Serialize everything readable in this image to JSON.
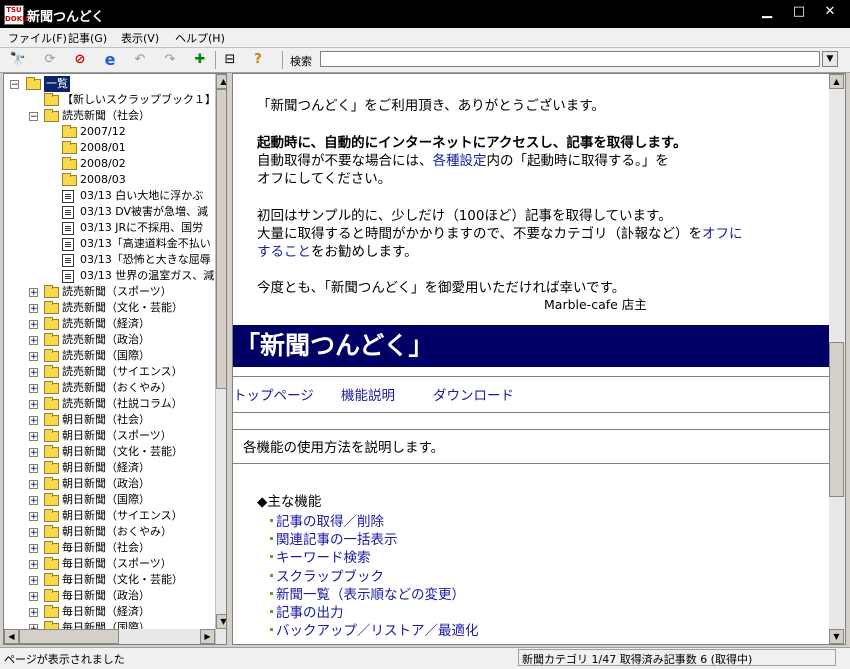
{
  "window": {
    "title": "新聞つんどく",
    "icon_text": "TSU DOKU"
  },
  "menu": [
    "ファイル(F)",
    "記事(G)",
    "表示(V)",
    "ヘルプ(H)"
  ],
  "toolbar": {
    "search_label": "検索",
    "search_value": "",
    "icons": [
      "binoculars-icon",
      "refresh-icon",
      "stop-icon",
      "ie-icon",
      "undo-icon",
      "redo-icon",
      "add-icon",
      "layout-icon",
      "help-icon"
    ]
  },
  "tree": {
    "root": "一覧",
    "items": [
      {
        "label": "【新しいスクラップブック１】",
        "type": "folder",
        "level": 1,
        "toggle": ""
      },
      {
        "label": "読売新聞（社会）",
        "type": "folder",
        "level": 1,
        "toggle": "-"
      },
      {
        "label": "2007/12",
        "type": "folder",
        "level": 2,
        "toggle": ""
      },
      {
        "label": "2008/01",
        "type": "folder",
        "level": 2,
        "toggle": ""
      },
      {
        "label": "2008/02",
        "type": "folder",
        "level": 2,
        "toggle": ""
      },
      {
        "label": "2008/03",
        "type": "folder",
        "level": 2,
        "toggle": ""
      },
      {
        "label": "03/13 白い大地に浮かぶ",
        "type": "doc",
        "level": 2,
        "toggle": ""
      },
      {
        "label": "03/13 DV被害が急増、減",
        "type": "doc",
        "level": 2,
        "toggle": ""
      },
      {
        "label": "03/13 JRに不採用、国労",
        "type": "doc",
        "level": 2,
        "toggle": ""
      },
      {
        "label": "03/13「高速道料金不払い",
        "type": "doc",
        "level": 2,
        "toggle": ""
      },
      {
        "label": "03/13「恐怖と大きな屈辱",
        "type": "doc",
        "level": 2,
        "toggle": ""
      },
      {
        "label": "03/13 世界の温室ガス、減",
        "type": "doc",
        "level": 2,
        "toggle": ""
      },
      {
        "label": "読売新聞（スポーツ）",
        "type": "folder",
        "level": 1,
        "toggle": "+"
      },
      {
        "label": "読売新聞（文化・芸能）",
        "type": "folder",
        "level": 1,
        "toggle": "+"
      },
      {
        "label": "読売新聞（経済）",
        "type": "folder",
        "level": 1,
        "toggle": "+"
      },
      {
        "label": "読売新聞（政治）",
        "type": "folder",
        "level": 1,
        "toggle": "+"
      },
      {
        "label": "読売新聞（国際）",
        "type": "folder",
        "level": 1,
        "toggle": "+"
      },
      {
        "label": "読売新聞（サイエンス）",
        "type": "folder",
        "level": 1,
        "toggle": "+"
      },
      {
        "label": "読売新聞（おくやみ）",
        "type": "folder",
        "level": 1,
        "toggle": "+"
      },
      {
        "label": "読売新聞（社説コラム）",
        "type": "folder",
        "level": 1,
        "toggle": "+"
      },
      {
        "label": "朝日新聞（社会）",
        "type": "folder",
        "level": 1,
        "toggle": "+"
      },
      {
        "label": "朝日新聞（スポーツ）",
        "type": "folder",
        "level": 1,
        "toggle": "+"
      },
      {
        "label": "朝日新聞（文化・芸能）",
        "type": "folder",
        "level": 1,
        "toggle": "+"
      },
      {
        "label": "朝日新聞（経済）",
        "type": "folder",
        "level": 1,
        "toggle": "+"
      },
      {
        "label": "朝日新聞（政治）",
        "type": "folder",
        "level": 1,
        "toggle": "+"
      },
      {
        "label": "朝日新聞（国際）",
        "type": "folder",
        "level": 1,
        "toggle": "+"
      },
      {
        "label": "朝日新聞（サイエンス）",
        "type": "folder",
        "level": 1,
        "toggle": "+"
      },
      {
        "label": "朝日新聞（おくやみ）",
        "type": "folder",
        "level": 1,
        "toggle": "+"
      },
      {
        "label": "毎日新聞（社会）",
        "type": "folder",
        "level": 1,
        "toggle": "+"
      },
      {
        "label": "毎日新聞（スポーツ）",
        "type": "folder",
        "level": 1,
        "toggle": "+"
      },
      {
        "label": "毎日新聞（文化・芸能）",
        "type": "folder",
        "level": 1,
        "toggle": "+"
      },
      {
        "label": "毎日新聞（政治）",
        "type": "folder",
        "level": 1,
        "toggle": "+"
      },
      {
        "label": "毎日新聞（経済）",
        "type": "folder",
        "level": 1,
        "toggle": "+"
      },
      {
        "label": "毎日新聞（国際）",
        "type": "folder",
        "level": 1,
        "toggle": "+"
      }
    ]
  },
  "content": {
    "welcome": "「新聞つんどく」をご利用頂き、ありがとうございます。",
    "auto_bold": "起動時に、自動的にインターネットにアクセスし、記事を取得します。",
    "auto_line2_pre": "自動取得が不要な場合には、",
    "auto_line2_link": "各種設定",
    "auto_line2_post": "内の「起動時に取得する。」を",
    "auto_line3": "オフにしてください。",
    "sample_line1": "初回はサンプル的に、少しだけ（100ほど）記事を取得しています。",
    "sample_line2_pre": "大量に取得すると時間がかかりますので、不要なカテゴリ（訃報など）を",
    "sample_line2_link": "オフに",
    "sample_line3_link": "すること",
    "sample_line3_post": "をお勧めします。",
    "closing": "今度とも、「新聞つんどく」を御愛用いただければ幸いです。",
    "signature": "Marble-cafe 店主",
    "banner": "「新聞つんどく」",
    "nav": [
      "トップページ",
      "機能説明",
      "ダウンロード"
    ],
    "description": "各機能の使用方法を説明します。",
    "features_heading": "◆主な機能",
    "features": [
      "記事の取得／削除",
      "関連記事の一括表示",
      "キーワード検索",
      "スクラップブック",
      "新聞一覧（表示順などの変更）",
      "記事の出力",
      "バックアップ／リストア／最適化"
    ]
  },
  "status": {
    "left": "ページが表示されました",
    "right": "新聞カテゴリ 1/47 取得済み記事数 6 (取得中)"
  },
  "colors": {
    "banner_bg": "#000066",
    "link": "#1a1aa0",
    "folder": "#f7d74e"
  }
}
